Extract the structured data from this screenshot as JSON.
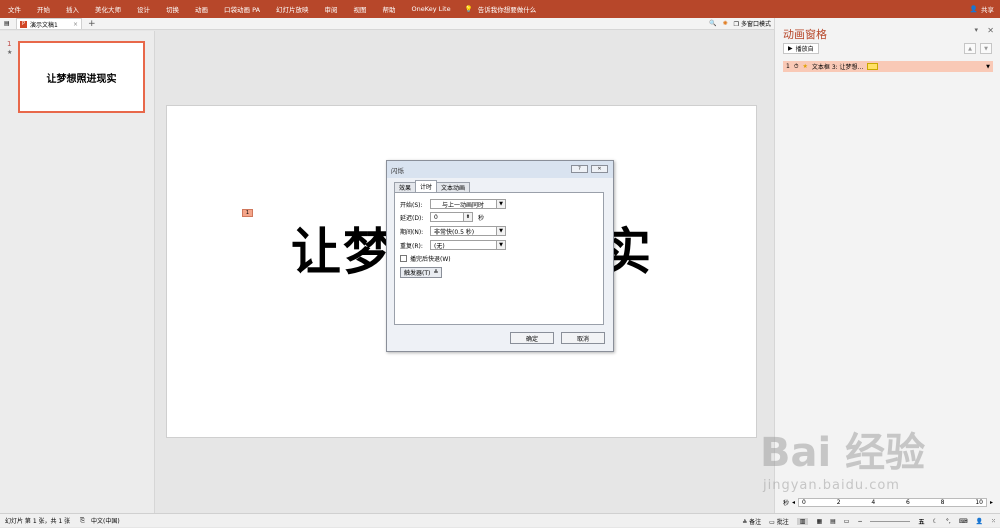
{
  "ribbon": {
    "tabs": [
      "文件",
      "开始",
      "插入",
      "美化大师",
      "设计",
      "切换",
      "动画",
      "口袋动画 PA",
      "幻灯片放映",
      "审阅",
      "视图",
      "帮助",
      "OneKey Lite"
    ],
    "tell_me": "告诉我你想要做什么",
    "share": "共享"
  },
  "tabbar": {
    "doc_tab": "演示文稿1",
    "window_mode": "多窗口模式"
  },
  "thumbnails": {
    "slide_number": "1",
    "slide_text": "让梦想照进现实"
  },
  "slide": {
    "marker": "1",
    "text_left": "让梦",
    "text_right": "实"
  },
  "dialog": {
    "title": "闪烁",
    "tabs": [
      "效果",
      "计时",
      "文本动画"
    ],
    "start_label": "开始(S):",
    "start_value": "与上一动画同时",
    "delay_label": "延迟(D):",
    "delay_value": "0",
    "delay_unit": "秒",
    "duration_label": "期间(N):",
    "duration_value": "非常快(0.5 秒)",
    "repeat_label": "重复(R):",
    "repeat_value": "(无)",
    "rewind_label": "播完后快退(W)",
    "trigger_button": "触发器(T)",
    "ok": "确定",
    "cancel": "取消"
  },
  "animation_pane": {
    "title": "动画窗格",
    "play_from": "播放自",
    "item_number": "1",
    "item_label": "文本框 3: 让梦想...",
    "timeline_unit": "秒",
    "timeline_ticks": [
      "0",
      "2",
      "4",
      "6",
      "8",
      "10"
    ]
  },
  "watermark": {
    "logo": "Bai 经验",
    "url": "jingyan.baidu.com"
  },
  "statusbar": {
    "slide_info": "幻灯片 第 1 张，共 1 张",
    "language": "中文(中国)",
    "notes": "备注",
    "comments": "批注",
    "ime": "五"
  },
  "colors": {
    "ribbon": "#b7472a",
    "selection": "#e8684a"
  }
}
